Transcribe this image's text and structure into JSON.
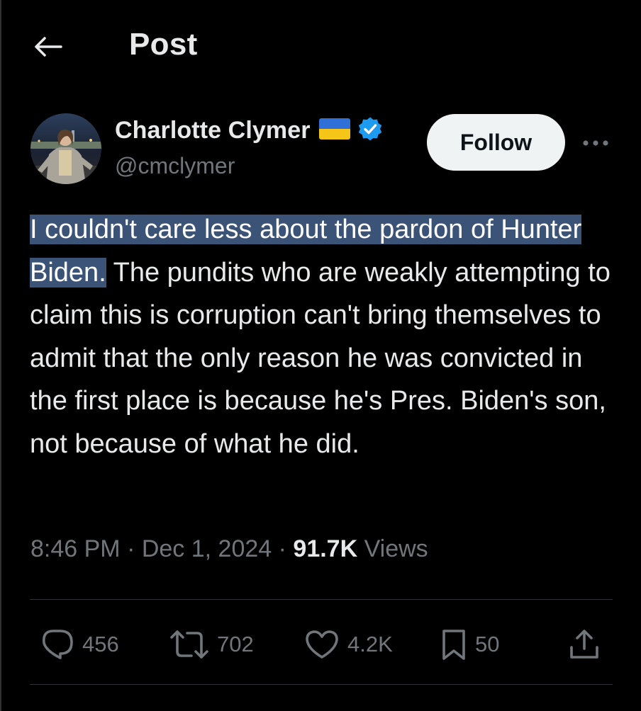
{
  "header": {
    "title": "Post"
  },
  "author": {
    "name": "Charlotte Clymer",
    "handle": "@cmclymer",
    "flag_icon": "ukraine-flag-icon",
    "verified_icon": "verified-badge-icon",
    "verified_color": "#1d9bf0"
  },
  "follow_button": {
    "label": "Follow"
  },
  "tweet": {
    "highlighted_text": "I couldn't care less about the pardon of Hunter Biden.",
    "rest_text": " The pundits who are weakly attempting to claim this is corruption can't bring themselves to admit that the only reason he was convicted in the first place is because he's Pres. Biden's son, not because of what he did.",
    "highlight_color": "#3b5377"
  },
  "meta": {
    "time": "8:46 PM",
    "separator": " · ",
    "date": "Dec 1, 2024",
    "views_count": "91.7K",
    "views_label": " Views"
  },
  "actions": {
    "replies": "456",
    "reposts": "702",
    "likes": "4.2K",
    "bookmarks": "50"
  },
  "colors": {
    "background": "#000000",
    "text": "#e7e9ea",
    "muted": "#71767b",
    "border": "#2f3336"
  }
}
